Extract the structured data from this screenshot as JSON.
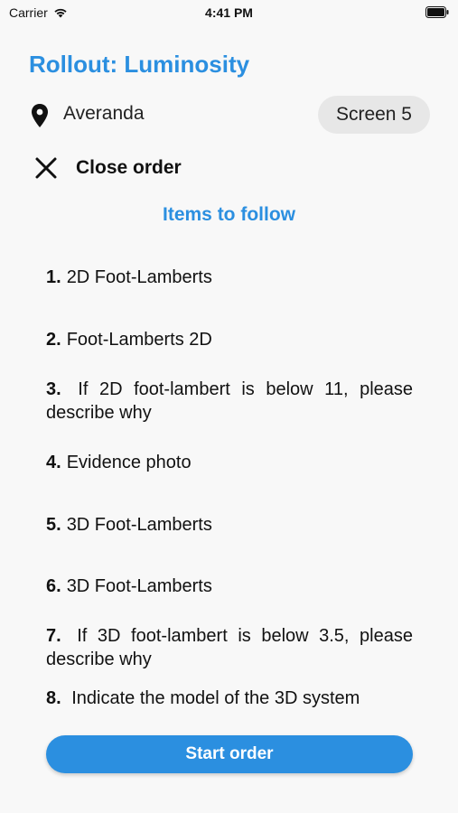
{
  "status_bar": {
    "carrier": "Carrier",
    "time": "4:41 PM"
  },
  "header": {
    "title": "Rollout: Luminosity"
  },
  "location": {
    "name": "Averanda",
    "screen_badge": "Screen 5"
  },
  "close": {
    "label": "Close order"
  },
  "section": {
    "title": "Items to follow"
  },
  "items": [
    {
      "number": "1.",
      "text": "2D Foot-Lamberts"
    },
    {
      "number": "2.",
      "text": "Foot-Lamberts 2D"
    },
    {
      "number": "3.",
      "text": "If 2D foot-lambert is below 11, please describe why"
    },
    {
      "number": "4.",
      "text": "Evidence photo"
    },
    {
      "number": "5.",
      "text": "3D Foot-Lamberts"
    },
    {
      "number": "6.",
      "text": "3D Foot-Lamberts"
    },
    {
      "number": "7.",
      "text": "If 3D foot-lambert is below 3.5, please describe why"
    },
    {
      "number": "8.",
      "text": "Indicate the model of the 3D system"
    }
  ],
  "footer": {
    "start_label": "Start order"
  },
  "colors": {
    "accent": "#2b8fe0",
    "badge_bg": "#e7e7e7",
    "background": "#f8f8f8"
  }
}
